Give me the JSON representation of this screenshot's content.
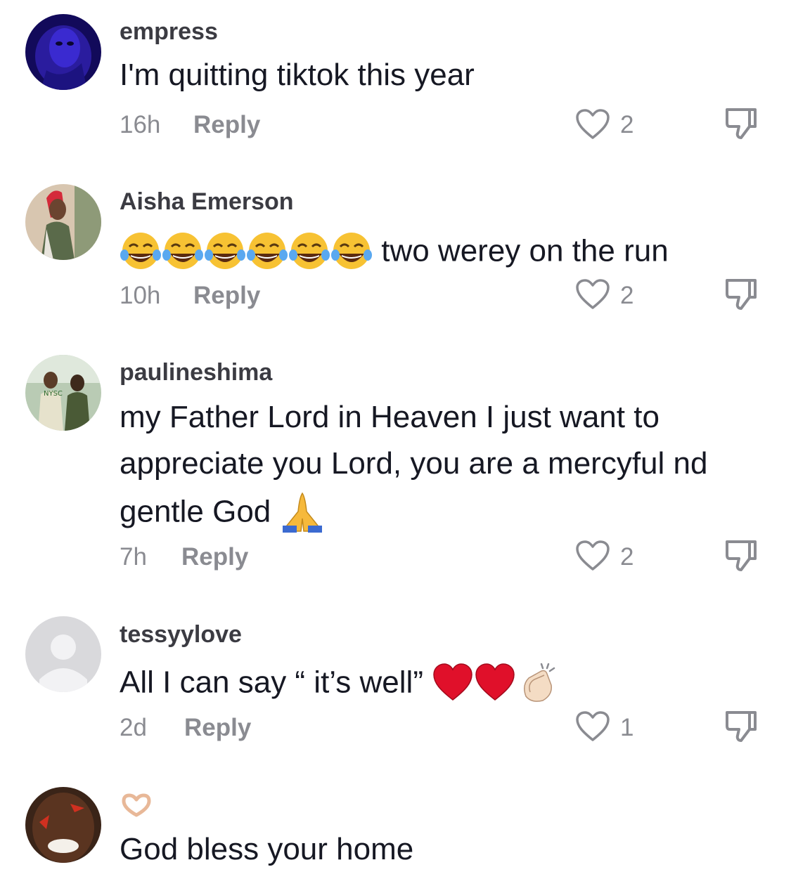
{
  "comments": [
    {
      "username": "empress",
      "text": "I'm quitting tiktok this year",
      "time": "16h",
      "reply": "Reply",
      "likes": "2"
    },
    {
      "username": "Aisha Emerson",
      "emoji_prefix": [
        "face-with-tears-of-joy",
        "face-with-tears-of-joy",
        "face-with-tears-of-joy",
        "face-with-tears-of-joy",
        "face-with-tears-of-joy",
        "face-with-tears-of-joy"
      ],
      "text": "two werey on the run",
      "time": "10h",
      "reply": "Reply",
      "likes": "2"
    },
    {
      "username": "paulineshima",
      "text_line1": "my Father Lord in Heaven I just want to",
      "text_line2": "appreciate you Lord, you are a mercyful nd",
      "text_line3": "gentle God",
      "emoji_suffix": [
        "folded-hands"
      ],
      "time": "7h",
      "reply": "Reply",
      "likes": "2"
    },
    {
      "username": "tessyylove",
      "text": "All I can say “ it’s well”",
      "emoji_suffix": [
        "red-heart",
        "red-heart",
        "clapping-hands"
      ],
      "time": "2d",
      "reply": "Reply",
      "likes": "1"
    },
    {
      "username_emoji": "heart-hands",
      "text": "God bless your home"
    }
  ],
  "colors": {
    "text": "#161823",
    "username": "#3b3b42",
    "muted": "#8a8b91"
  },
  "icons": {
    "like": "heart-outline-icon",
    "dislike": "thumbs-down-outline-icon"
  }
}
